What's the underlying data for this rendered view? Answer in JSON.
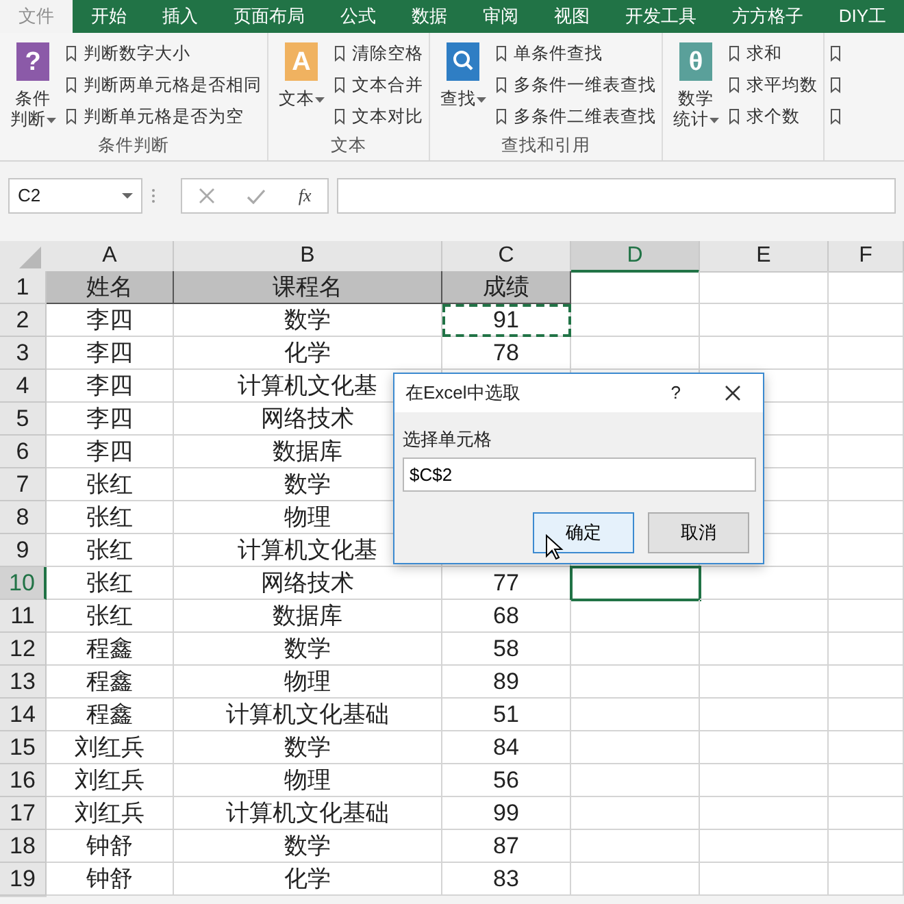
{
  "ribbon": {
    "tabs": [
      {
        "label": "文件",
        "kind": "file"
      },
      {
        "label": "开始",
        "kind": "tab"
      },
      {
        "label": "插入",
        "kind": "tab"
      },
      {
        "label": "页面布局",
        "kind": "tab"
      },
      {
        "label": "公式",
        "kind": "tab"
      },
      {
        "label": "数据",
        "kind": "tab"
      },
      {
        "label": "审阅",
        "kind": "tab"
      },
      {
        "label": "视图",
        "kind": "tab"
      },
      {
        "label": "开发工具",
        "kind": "tab"
      },
      {
        "label": "方方格子",
        "kind": "tab"
      },
      {
        "label": "DIY工",
        "kind": "tab"
      }
    ],
    "groups": [
      {
        "title": "条件判断",
        "big_label": "条件判断",
        "icon": {
          "kind": "glyph",
          "glyph": "?",
          "color": "#8b5aa8"
        },
        "items": [
          "判断数字大小",
          "判断两单元格是否相同",
          "判断单元格是否为空"
        ]
      },
      {
        "title": "文本",
        "big_label": "文本",
        "icon": {
          "kind": "glyph",
          "glyph": "A",
          "color": "#f0b260"
        },
        "items": [
          "清除空格",
          "文本合并",
          "文本对比"
        ]
      },
      {
        "title": "查找和引用",
        "big_label": "查找",
        "icon": {
          "kind": "search",
          "color": "#2f7ec4"
        },
        "items": [
          "单条件查找",
          "多条件一维表查找",
          "多条件二维表查找"
        ]
      },
      {
        "big_label": "数学统计",
        "icon": {
          "kind": "glyph",
          "glyph": "θ",
          "color": "#5aa09a"
        },
        "items": [
          "求和",
          "求平均数",
          "求个数"
        ]
      }
    ]
  },
  "formula_bar": {
    "name_box": "C2",
    "fx": "fx"
  },
  "sheet": {
    "columns": [
      {
        "label": "A",
        "selected": false
      },
      {
        "label": "B",
        "selected": false
      },
      {
        "label": "C",
        "selected": false
      },
      {
        "label": "D",
        "selected": true
      },
      {
        "label": "E",
        "selected": false
      },
      {
        "label": "F",
        "selected": false
      }
    ],
    "rows": [
      {
        "header": "1",
        "selected": false,
        "kind": "header",
        "cells": [
          {
            "text": "姓名",
            "marquee": false
          },
          {
            "text": "课程名",
            "marquee": false
          },
          {
            "text": "成绩",
            "marquee": false
          }
        ]
      },
      {
        "header": "2",
        "selected": false,
        "kind": "data",
        "cells": [
          {
            "text": "李四",
            "marquee": false
          },
          {
            "text": "数学",
            "marquee": false
          },
          {
            "text": "91",
            "marquee": true
          }
        ]
      },
      {
        "header": "3",
        "selected": false,
        "kind": "data",
        "cells": [
          {
            "text": "李四",
            "marquee": false
          },
          {
            "text": "化学",
            "marquee": false
          },
          {
            "text": "78",
            "marquee": false
          }
        ]
      },
      {
        "header": "4",
        "selected": false,
        "kind": "data",
        "cells": [
          {
            "text": "李四",
            "marquee": false
          },
          {
            "text": "计算机文化基",
            "marquee": false
          }
        ]
      },
      {
        "header": "5",
        "selected": false,
        "kind": "data",
        "cells": [
          {
            "text": "李四",
            "marquee": false
          },
          {
            "text": "网络技术",
            "marquee": false
          }
        ]
      },
      {
        "header": "6",
        "selected": false,
        "kind": "data",
        "cells": [
          {
            "text": "李四",
            "marquee": false
          },
          {
            "text": "数据库",
            "marquee": false
          }
        ]
      },
      {
        "header": "7",
        "selected": false,
        "kind": "data",
        "cells": [
          {
            "text": "张红",
            "marquee": false
          },
          {
            "text": "数学",
            "marquee": false
          }
        ]
      },
      {
        "header": "8",
        "selected": false,
        "kind": "data",
        "cells": [
          {
            "text": "张红",
            "marquee": false
          },
          {
            "text": "物理",
            "marquee": false
          }
        ]
      },
      {
        "header": "9",
        "selected": false,
        "kind": "data",
        "cells": [
          {
            "text": "张红",
            "marquee": false
          },
          {
            "text": "计算机文化基",
            "marquee": false
          }
        ]
      },
      {
        "header": "10",
        "selected": true,
        "kind": "data",
        "cells": [
          {
            "text": "张红",
            "marquee": false
          },
          {
            "text": "网络技术",
            "marquee": false
          },
          {
            "text": "77",
            "marquee": false
          }
        ]
      },
      {
        "header": "11",
        "selected": false,
        "kind": "data",
        "cells": [
          {
            "text": "张红",
            "marquee": false
          },
          {
            "text": "数据库",
            "marquee": false
          },
          {
            "text": "68",
            "marquee": false
          }
        ]
      },
      {
        "header": "12",
        "selected": false,
        "kind": "data",
        "cells": [
          {
            "text": "程鑫",
            "marquee": false
          },
          {
            "text": "数学",
            "marquee": false
          },
          {
            "text": "58",
            "marquee": false
          }
        ]
      },
      {
        "header": "13",
        "selected": false,
        "kind": "data",
        "cells": [
          {
            "text": "程鑫",
            "marquee": false
          },
          {
            "text": "物理",
            "marquee": false
          },
          {
            "text": "89",
            "marquee": false
          }
        ]
      },
      {
        "header": "14",
        "selected": false,
        "kind": "data",
        "cells": [
          {
            "text": "程鑫",
            "marquee": false
          },
          {
            "text": "计算机文化基础",
            "marquee": false
          },
          {
            "text": "51",
            "marquee": false
          }
        ]
      },
      {
        "header": "15",
        "selected": false,
        "kind": "data",
        "cells": [
          {
            "text": "刘红兵",
            "marquee": false
          },
          {
            "text": "数学",
            "marquee": false
          },
          {
            "text": "84",
            "marquee": false
          }
        ]
      },
      {
        "header": "16",
        "selected": false,
        "kind": "data",
        "cells": [
          {
            "text": "刘红兵",
            "marquee": false
          },
          {
            "text": "物理",
            "marquee": false
          },
          {
            "text": "56",
            "marquee": false
          }
        ]
      },
      {
        "header": "17",
        "selected": false,
        "kind": "data",
        "cells": [
          {
            "text": "刘红兵",
            "marquee": false
          },
          {
            "text": "计算机文化基础",
            "marquee": false
          },
          {
            "text": "99",
            "marquee": false
          }
        ]
      },
      {
        "header": "18",
        "selected": false,
        "kind": "data",
        "cells": [
          {
            "text": "钟舒",
            "marquee": false
          },
          {
            "text": "数学",
            "marquee": false
          },
          {
            "text": "87",
            "marquee": false
          }
        ]
      },
      {
        "header": "19",
        "selected": false,
        "kind": "data",
        "cells": [
          {
            "text": "钟舒",
            "marquee": false
          },
          {
            "text": "化学",
            "marquee": false
          },
          {
            "text": "83",
            "marquee": false
          }
        ]
      }
    ]
  },
  "dialog": {
    "title": "在Excel中选取",
    "help": "?",
    "label": "选择单元格",
    "value": "$C$2",
    "buttons": [
      {
        "label": "确定",
        "focused": true
      },
      {
        "label": "取消",
        "focused": false
      }
    ]
  }
}
